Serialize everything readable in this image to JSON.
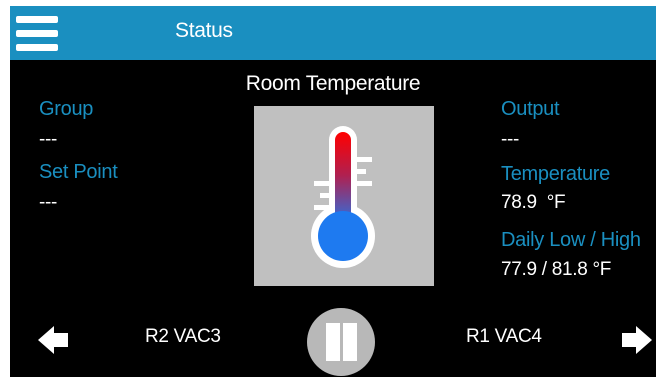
{
  "header": {
    "title": "Status",
    "menu_icon": "hamburger-menu-icon",
    "background_color": "#1a8fc0"
  },
  "left_panel": {
    "group_label": "Group",
    "group_value": "---",
    "set_point_label": "Set Point",
    "set_point_value": "---"
  },
  "center": {
    "title": "Room Temperature",
    "icon": "thermometer-icon"
  },
  "right_panel": {
    "output_label": "Output",
    "output_value": "---",
    "temperature_label": "Temperature",
    "temperature_value": "78.9  °F",
    "daily_label": "Daily Low / High",
    "daily_value": "77.9 / 81.8 °F"
  },
  "footer": {
    "prev_icon": "arrow-left-icon",
    "prev_label": "R2 VAC3",
    "pause_icon": "pause-icon",
    "next_label": "R1 VAC4",
    "next_icon": "arrow-right-icon"
  },
  "colors": {
    "accent": "#1a8fc0",
    "background": "#000000",
    "panel": "#c0c0c0"
  }
}
